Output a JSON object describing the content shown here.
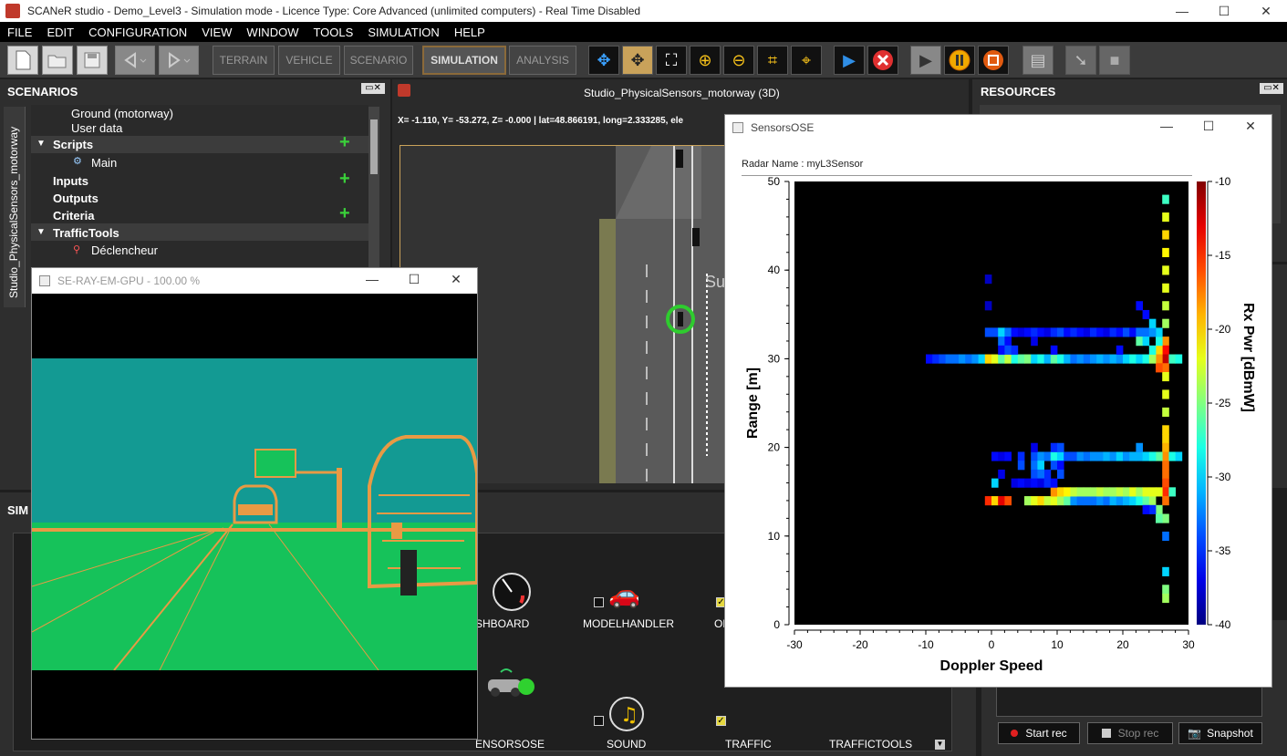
{
  "window": {
    "title": "SCANeR studio - Demo_Level3 - Simulation mode - Licence Type: Core Advanced (unlimited computers) - Real Time Disabled",
    "minimize": "—",
    "maximize": "☐",
    "close": "✕"
  },
  "menu": [
    "FILE",
    "EDIT",
    "CONFIGURATION",
    "VIEW",
    "WINDOW",
    "TOOLS",
    "SIMULATION",
    "HELP"
  ],
  "toolbar": {
    "modes": [
      "TERRAIN",
      "VEHICLE",
      "SCENARIO",
      "SIMULATION",
      "ANALYSIS"
    ]
  },
  "scenarios_panel": {
    "title": "SCENARIOS",
    "side_tab": "Studio_PhysicalSensors_motorway",
    "items": [
      {
        "label": "Ground (motorway)"
      },
      {
        "label": "User data"
      },
      {
        "label": "Scripts"
      },
      {
        "label": "Main"
      },
      {
        "label": "Inputs"
      },
      {
        "label": "Outputs"
      },
      {
        "label": "Criteria"
      },
      {
        "label": "TrafficTools"
      },
      {
        "label": "Déclencheur"
      }
    ],
    "add": "+"
  },
  "view3d": {
    "title": "Studio_PhysicalSensors_motorway (3D)",
    "coords": "X=  -1.110, Y= -53.272, Z=  -0.000 | lat=48.866191, long=2.333285, ele"
  },
  "resources_panel": {
    "title": "RESOURCES"
  },
  "simulation_panel": {
    "title": "SIM",
    "modules": [
      {
        "label": "ASHBOARD"
      },
      {
        "label": "MODELHANDLER"
      },
      {
        "label": "OFFLI"
      },
      {
        "label": "ENSORSOSE"
      },
      {
        "label": "SOUND"
      },
      {
        "label": "TRAFFIC"
      },
      {
        "label": "TRAFFICTOOLS"
      }
    ]
  },
  "record": {
    "start": "Start rec",
    "stop": "Stop rec",
    "snapshot": "Snapshot"
  },
  "ray_window": {
    "title": "SE-RAY-EM-GPU - 100.00 %"
  },
  "sensors_window": {
    "title": "SensorsOSE",
    "radar_label": "Radar Name : myL3Sensor"
  },
  "chart_data": {
    "type": "heatmap",
    "xlabel": "Doppler Speed",
    "ylabel": "Range [m]",
    "colorbar_label": "Rx Pwr [dBmW]",
    "xlim": [
      -30,
      30
    ],
    "ylim": [
      0,
      50
    ],
    "clim": [
      -40,
      -10
    ],
    "xticks": [
      -30,
      -20,
      -10,
      0,
      10,
      20,
      30
    ],
    "yticks": [
      0,
      10,
      20,
      30,
      40,
      50
    ],
    "cticks": [
      -10,
      -15,
      -20,
      -25,
      -30,
      -35,
      -40
    ],
    "cells": [
      {
        "x": 26.5,
        "y": 48,
        "v": -27
      },
      {
        "x": 26.5,
        "y": 46,
        "v": -22
      },
      {
        "x": 26.5,
        "y": 44,
        "v": -20
      },
      {
        "x": 26.5,
        "y": 42,
        "v": -21
      },
      {
        "x": 26.5,
        "y": 40,
        "v": -22
      },
      {
        "x": 26.5,
        "y": 38,
        "v": -22
      },
      {
        "x": 26.5,
        "y": 36,
        "v": -23
      },
      {
        "x": 26.5,
        "y": 34,
        "v": -24
      },
      {
        "x": 26.5,
        "y": 32,
        "v": -18
      },
      {
        "x": 26.5,
        "y": 31,
        "v": -14
      },
      {
        "x": 26.5,
        "y": 30,
        "v": -12
      },
      {
        "x": 26.5,
        "y": 29,
        "v": -17
      },
      {
        "x": 26.5,
        "y": 28,
        "v": -22
      },
      {
        "x": 26.5,
        "y": 26,
        "v": -22
      },
      {
        "x": 26.5,
        "y": 24,
        "v": -23
      },
      {
        "x": 26.5,
        "y": 22,
        "v": -20
      },
      {
        "x": 26.5,
        "y": 21,
        "v": -20
      },
      {
        "x": 26.5,
        "y": 20,
        "v": -19
      },
      {
        "x": 26.5,
        "y": 19,
        "v": -18
      },
      {
        "x": 26.5,
        "y": 18,
        "v": -17
      },
      {
        "x": 26.5,
        "y": 17,
        "v": -17
      },
      {
        "x": 26.5,
        "y": 16,
        "v": -16
      },
      {
        "x": 26.5,
        "y": 15,
        "v": -15
      },
      {
        "x": 26.5,
        "y": 14,
        "v": -17
      },
      {
        "x": 26.5,
        "y": 12,
        "v": -25
      },
      {
        "x": 26.5,
        "y": 10,
        "v": -33
      },
      {
        "x": 26.5,
        "y": 6,
        "v": -30
      },
      {
        "x": 26.5,
        "y": 4,
        "v": -25
      },
      {
        "x": 26.5,
        "y": 3,
        "v": -24
      },
      {
        "x": 25.5,
        "y": 31,
        "v": -20
      },
      {
        "x": 25.5,
        "y": 30,
        "v": -18
      },
      {
        "x": 25.5,
        "y": 29,
        "v": -16
      },
      {
        "x": 25.5,
        "y": 32,
        "v": -28
      },
      {
        "x": 25.5,
        "y": 33,
        "v": -30
      },
      {
        "x": 25.5,
        "y": 19,
        "v": -26
      },
      {
        "x": 25.5,
        "y": 15,
        "v": -22
      },
      {
        "x": 25.5,
        "y": 13,
        "v": -25
      },
      {
        "x": 25.5,
        "y": 12,
        "v": -26
      },
      {
        "x": 27.5,
        "y": 30,
        "v": -27
      },
      {
        "x": 27.5,
        "y": 19,
        "v": -28
      },
      {
        "x": 28.5,
        "y": 19,
        "v": -30
      },
      {
        "x": 27.5,
        "y": 15,
        "v": -27
      },
      {
        "x": -9.5,
        "y": 30,
        "v": -36
      },
      {
        "x": -8.5,
        "y": 30,
        "v": -35
      },
      {
        "x": -7.5,
        "y": 30,
        "v": -34
      },
      {
        "x": -6.5,
        "y": 30,
        "v": -33
      },
      {
        "x": -5.5,
        "y": 30,
        "v": -33
      },
      {
        "x": -4.5,
        "y": 30,
        "v": -32
      },
      {
        "x": -3.5,
        "y": 30,
        "v": -33
      },
      {
        "x": -2.5,
        "y": 30,
        "v": -32
      },
      {
        "x": -1.5,
        "y": 30,
        "v": -30
      },
      {
        "x": -0.5,
        "y": 30,
        "v": -20
      },
      {
        "x": 0.5,
        "y": 30,
        "v": -22
      },
      {
        "x": 1.5,
        "y": 30,
        "v": -26
      },
      {
        "x": 2.5,
        "y": 30,
        "v": -23
      },
      {
        "x": 3.5,
        "y": 30,
        "v": -28
      },
      {
        "x": 4.5,
        "y": 30,
        "v": -26
      },
      {
        "x": 5.5,
        "y": 30,
        "v": -25
      },
      {
        "x": 6.5,
        "y": 30,
        "v": -30
      },
      {
        "x": 7.5,
        "y": 30,
        "v": -28
      },
      {
        "x": 8.5,
        "y": 30,
        "v": -31
      },
      {
        "x": 9.5,
        "y": 30,
        "v": -26
      },
      {
        "x": 10.5,
        "y": 30,
        "v": -28
      },
      {
        "x": 11.5,
        "y": 30,
        "v": -31
      },
      {
        "x": 12.5,
        "y": 30,
        "v": -33
      },
      {
        "x": 13.5,
        "y": 30,
        "v": -32
      },
      {
        "x": 14.5,
        "y": 30,
        "v": -33
      },
      {
        "x": 15.5,
        "y": 30,
        "v": -32
      },
      {
        "x": 16.5,
        "y": 30,
        "v": -31
      },
      {
        "x": 17.5,
        "y": 30,
        "v": -32
      },
      {
        "x": 18.5,
        "y": 30,
        "v": -31
      },
      {
        "x": 19.5,
        "y": 30,
        "v": -32
      },
      {
        "x": 20.5,
        "y": 30,
        "v": -30
      },
      {
        "x": 21.5,
        "y": 30,
        "v": -28
      },
      {
        "x": 22.5,
        "y": 30,
        "v": -30
      },
      {
        "x": 23.5,
        "y": 30,
        "v": -28
      },
      {
        "x": 24.5,
        "y": 30,
        "v": -24
      },
      {
        "x": 28.5,
        "y": 30,
        "v": -28
      },
      {
        "x": -0.5,
        "y": 33,
        "v": -34
      },
      {
        "x": 0.5,
        "y": 33,
        "v": -34
      },
      {
        "x": 1.5,
        "y": 33,
        "v": -30
      },
      {
        "x": 2.5,
        "y": 33,
        "v": -33
      },
      {
        "x": 3.5,
        "y": 33,
        "v": -36
      },
      {
        "x": 4.5,
        "y": 33,
        "v": -37
      },
      {
        "x": 5.5,
        "y": 33,
        "v": -36
      },
      {
        "x": 6.5,
        "y": 33,
        "v": -35
      },
      {
        "x": 7.5,
        "y": 33,
        "v": -36
      },
      {
        "x": 8.5,
        "y": 33,
        "v": -37
      },
      {
        "x": 9.5,
        "y": 33,
        "v": -35
      },
      {
        "x": 10.5,
        "y": 33,
        "v": -34
      },
      {
        "x": 11.5,
        "y": 33,
        "v": -36
      },
      {
        "x": 12.5,
        "y": 33,
        "v": -35
      },
      {
        "x": 13.5,
        "y": 33,
        "v": -36
      },
      {
        "x": 14.5,
        "y": 33,
        "v": -37
      },
      {
        "x": 15.5,
        "y": 33,
        "v": -35
      },
      {
        "x": 16.5,
        "y": 33,
        "v": -36
      },
      {
        "x": 17.5,
        "y": 33,
        "v": -37
      },
      {
        "x": 18.5,
        "y": 33,
        "v": -35
      },
      {
        "x": 19.5,
        "y": 33,
        "v": -36
      },
      {
        "x": 20.5,
        "y": 33,
        "v": -34
      },
      {
        "x": 21.5,
        "y": 33,
        "v": -36
      },
      {
        "x": 22.5,
        "y": 33,
        "v": -33
      },
      {
        "x": 23.5,
        "y": 33,
        "v": -33
      },
      {
        "x": 24.5,
        "y": 33,
        "v": -32
      },
      {
        "x": 1.5,
        "y": 32,
        "v": -33
      },
      {
        "x": 2.5,
        "y": 32,
        "v": -36
      },
      {
        "x": 6.5,
        "y": 32,
        "v": -37
      },
      {
        "x": 22.5,
        "y": 32,
        "v": -26
      },
      {
        "x": 23.5,
        "y": 32,
        "v": -30
      },
      {
        "x": 24.5,
        "y": 31,
        "v": -28
      },
      {
        "x": 1.5,
        "y": 31,
        "v": -36
      },
      {
        "x": 2.5,
        "y": 31,
        "v": -34
      },
      {
        "x": 3.5,
        "y": 31,
        "v": -35
      },
      {
        "x": 9.5,
        "y": 31,
        "v": -36
      },
      {
        "x": 19.5,
        "y": 31,
        "v": -36
      },
      {
        "x": 24.5,
        "y": 34,
        "v": -30
      },
      {
        "x": -0.5,
        "y": 14,
        "v": -15
      },
      {
        "x": 0.5,
        "y": 14,
        "v": -20
      },
      {
        "x": 1.5,
        "y": 14,
        "v": -13
      },
      {
        "x": 2.5,
        "y": 14,
        "v": -16
      },
      {
        "x": 5.5,
        "y": 14,
        "v": -24
      },
      {
        "x": 6.5,
        "y": 14,
        "v": -22
      },
      {
        "x": 7.5,
        "y": 14,
        "v": -20
      },
      {
        "x": 8.5,
        "y": 14,
        "v": -23
      },
      {
        "x": 9.5,
        "y": 14,
        "v": -22
      },
      {
        "x": 10.5,
        "y": 14,
        "v": -24
      },
      {
        "x": 11.5,
        "y": 14,
        "v": -26
      },
      {
        "x": 12.5,
        "y": 14,
        "v": -32
      },
      {
        "x": 13.5,
        "y": 14,
        "v": -33
      },
      {
        "x": 14.5,
        "y": 14,
        "v": -33
      },
      {
        "x": 15.5,
        "y": 14,
        "v": -33
      },
      {
        "x": 16.5,
        "y": 14,
        "v": -32
      },
      {
        "x": 17.5,
        "y": 14,
        "v": -33
      },
      {
        "x": 18.5,
        "y": 14,
        "v": -31
      },
      {
        "x": 19.5,
        "y": 14,
        "v": -32
      },
      {
        "x": 20.5,
        "y": 14,
        "v": -31
      },
      {
        "x": 21.5,
        "y": 14,
        "v": -30
      },
      {
        "x": 22.5,
        "y": 14,
        "v": -28
      },
      {
        "x": 23.5,
        "y": 14,
        "v": -26
      },
      {
        "x": 24.5,
        "y": 14,
        "v": -24
      },
      {
        "x": 9.5,
        "y": 15,
        "v": -18
      },
      {
        "x": 10.5,
        "y": 15,
        "v": -20
      },
      {
        "x": 11.5,
        "y": 15,
        "v": -21
      },
      {
        "x": 12.5,
        "y": 15,
        "v": -23
      },
      {
        "x": 13.5,
        "y": 15,
        "v": -24
      },
      {
        "x": 14.5,
        "y": 15,
        "v": -24
      },
      {
        "x": 15.5,
        "y": 15,
        "v": -24
      },
      {
        "x": 16.5,
        "y": 15,
        "v": -23
      },
      {
        "x": 17.5,
        "y": 15,
        "v": -24
      },
      {
        "x": 18.5,
        "y": 15,
        "v": -24
      },
      {
        "x": 19.5,
        "y": 15,
        "v": -23
      },
      {
        "x": 20.5,
        "y": 15,
        "v": -24
      },
      {
        "x": 21.5,
        "y": 15,
        "v": -22
      },
      {
        "x": 22.5,
        "y": 15,
        "v": -24
      },
      {
        "x": 23.5,
        "y": 15,
        "v": -22
      },
      {
        "x": 24.5,
        "y": 15,
        "v": -22
      },
      {
        "x": 0.5,
        "y": 16,
        "v": -30
      },
      {
        "x": 0.5,
        "y": 19,
        "v": -36
      },
      {
        "x": 1.5,
        "y": 19,
        "v": -37
      },
      {
        "x": 2.5,
        "y": 19,
        "v": -36
      },
      {
        "x": 4.5,
        "y": 19,
        "v": -35
      },
      {
        "x": 6.5,
        "y": 19,
        "v": -34
      },
      {
        "x": 7.5,
        "y": 19,
        "v": -32
      },
      {
        "x": 8.5,
        "y": 19,
        "v": -33
      },
      {
        "x": 9.5,
        "y": 19,
        "v": -28
      },
      {
        "x": 10.5,
        "y": 19,
        "v": -30
      },
      {
        "x": 11.5,
        "y": 19,
        "v": -34
      },
      {
        "x": 12.5,
        "y": 19,
        "v": -34
      },
      {
        "x": 13.5,
        "y": 19,
        "v": -32
      },
      {
        "x": 14.5,
        "y": 19,
        "v": -33
      },
      {
        "x": 15.5,
        "y": 19,
        "v": -32
      },
      {
        "x": 16.5,
        "y": 19,
        "v": -32
      },
      {
        "x": 17.5,
        "y": 19,
        "v": -31
      },
      {
        "x": 18.5,
        "y": 19,
        "v": -32
      },
      {
        "x": 19.5,
        "y": 19,
        "v": -30
      },
      {
        "x": 20.5,
        "y": 19,
        "v": -32
      },
      {
        "x": 21.5,
        "y": 19,
        "v": -31
      },
      {
        "x": 22.5,
        "y": 19,
        "v": -31
      },
      {
        "x": 23.5,
        "y": 19,
        "v": -30
      },
      {
        "x": 24.5,
        "y": 19,
        "v": -28
      },
      {
        "x": 4.5,
        "y": 18,
        "v": -34
      },
      {
        "x": 6.5,
        "y": 18,
        "v": -33
      },
      {
        "x": 7.5,
        "y": 18,
        "v": -30
      },
      {
        "x": 9.5,
        "y": 18,
        "v": -34
      },
      {
        "x": 10.5,
        "y": 18,
        "v": -36
      },
      {
        "x": 6.5,
        "y": 17,
        "v": -34
      },
      {
        "x": 9.5,
        "y": 20,
        "v": -35
      },
      {
        "x": 10.5,
        "y": 20,
        "v": -34
      },
      {
        "x": 6.5,
        "y": 20,
        "v": -37
      },
      {
        "x": 8.5,
        "y": 17,
        "v": -35
      },
      {
        "x": 7.5,
        "y": 17,
        "v": -33
      },
      {
        "x": 10.5,
        "y": 17,
        "v": -34
      },
      {
        "x": 1.5,
        "y": 17,
        "v": -37
      },
      {
        "x": 3.5,
        "y": 16,
        "v": -37
      },
      {
        "x": 4.5,
        "y": 16,
        "v": -36
      },
      {
        "x": 5.5,
        "y": 16,
        "v": -37
      },
      {
        "x": 6.5,
        "y": 16,
        "v": -36
      },
      {
        "x": 7.5,
        "y": 16,
        "v": -37
      },
      {
        "x": 8.5,
        "y": 16,
        "v": -35
      },
      {
        "x": 9.5,
        "y": 16,
        "v": -36
      },
      {
        "x": 22.5,
        "y": 20,
        "v": -32
      },
      {
        "x": 24.5,
        "y": 13,
        "v": -35
      },
      {
        "x": 23.5,
        "y": 13,
        "v": -36
      },
      {
        "x": -0.5,
        "y": 36,
        "v": -38
      },
      {
        "x": -0.5,
        "y": 39,
        "v": -38
      },
      {
        "x": 22.5,
        "y": 36,
        "v": -36
      },
      {
        "x": 23.5,
        "y": 35,
        "v": -36
      }
    ]
  }
}
